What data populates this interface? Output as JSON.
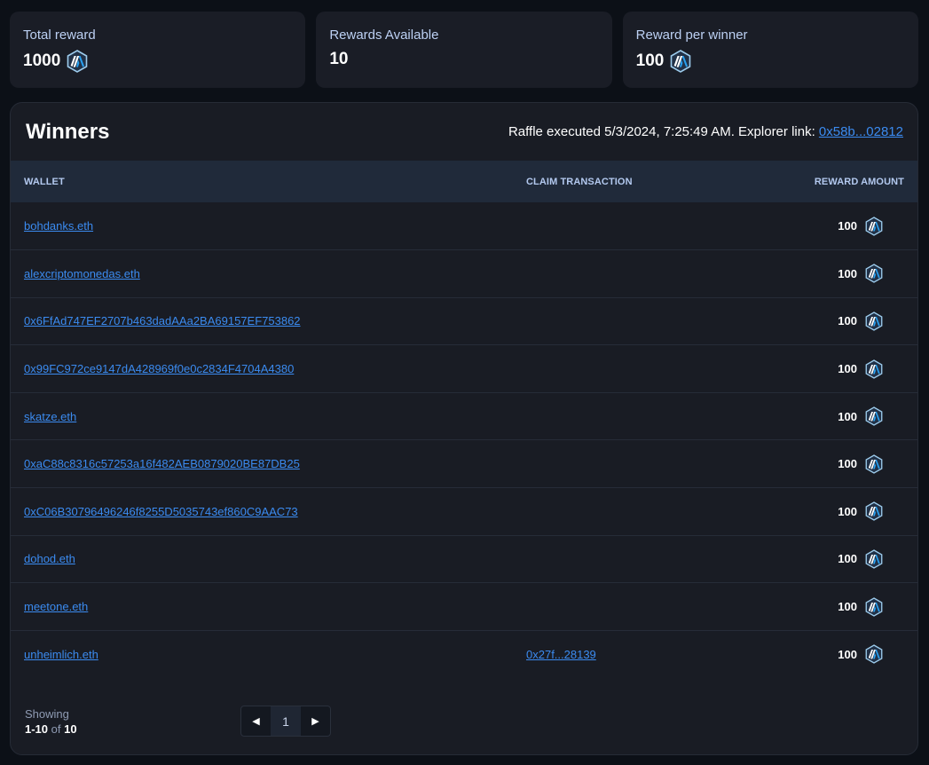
{
  "stats": [
    {
      "label": "Total reward",
      "value": "1000",
      "token_icon": "arbitrum-icon"
    },
    {
      "label": "Rewards Available",
      "value": "10",
      "token_icon": null
    },
    {
      "label": "Reward per winner",
      "value": "100",
      "token_icon": "arbitrum-icon"
    }
  ],
  "winners": {
    "title": "Winners",
    "raffle_info_prefix": "Raffle executed 5/3/2024, 7:25:49 AM. Explorer link: ",
    "explorer_link": "0x58b...02812",
    "columns": {
      "wallet": "WALLET",
      "claim_transaction": "CLAIM TRANSACTION",
      "reward_amount": "REWARD AMOUNT"
    },
    "rows": [
      {
        "wallet": "bohdanks.eth",
        "claim_tx": "",
        "reward": "100"
      },
      {
        "wallet": "alexcriptomonedas.eth",
        "claim_tx": "",
        "reward": "100"
      },
      {
        "wallet": "0x6FfAd747EF2707b463dadAAa2BA69157EF753862",
        "claim_tx": "",
        "reward": "100"
      },
      {
        "wallet": "0x99FC972ce9147dA428969f0e0c2834F4704A4380",
        "claim_tx": "",
        "reward": "100"
      },
      {
        "wallet": "skatze.eth",
        "claim_tx": "",
        "reward": "100"
      },
      {
        "wallet": "0xaC88c8316c57253a16f482AEB0879020BE87DB25",
        "claim_tx": "",
        "reward": "100"
      },
      {
        "wallet": "0xC06B30796496246f8255D5035743ef860C9AAC73",
        "claim_tx": "",
        "reward": "100"
      },
      {
        "wallet": "dohod.eth",
        "claim_tx": "",
        "reward": "100"
      },
      {
        "wallet": "meetone.eth",
        "claim_tx": "",
        "reward": "100"
      },
      {
        "wallet": "unheimlich.eth",
        "claim_tx": "0x27f...28139",
        "reward": "100"
      }
    ]
  },
  "pagination": {
    "showing_label": "Showing",
    "range": "1-10",
    "of_label": "of",
    "total": "10",
    "current_page": "1",
    "prev_icon": "caret-left-icon",
    "next_icon": "caret-right-icon"
  },
  "colors": {
    "background": "#0c1017",
    "card": "#1a1d26",
    "table_header": "#202a3a",
    "link": "#3b8bf0",
    "label": "#bcd0f3"
  }
}
